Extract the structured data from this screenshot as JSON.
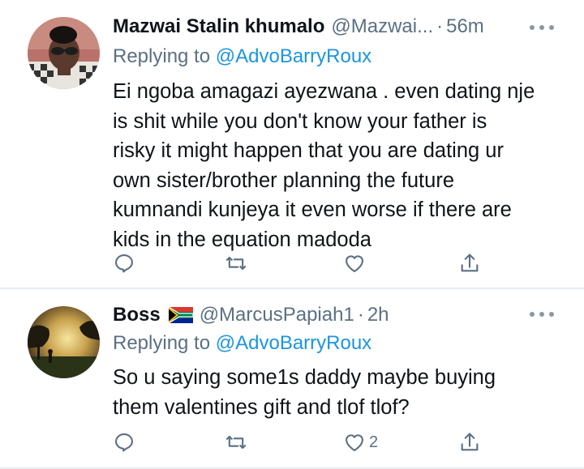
{
  "tweets": [
    {
      "name": "Mazwai Stalin khumalo",
      "handle": "@Mazwai...",
      "time": "56m",
      "replying_label": "Replying to",
      "replying_to": "@AdvoBarryRoux",
      "lines": [
        "Ei ngoba amagazi ayezwana . even  dating nje",
        "is shit while you don't know your  father is",
        "risky it might happen that you are dating ur",
        "own sister/brother planning the future",
        "kumnandi kunjeya it even worse if there are",
        "kids in the equation madoda"
      ],
      "like_count": ""
    },
    {
      "name": "Boss",
      "flag": "south-africa-flag",
      "handle": "@MarcusPapiah1",
      "time": "2h",
      "replying_label": "Replying to",
      "replying_to": "@AdvoBarryRoux",
      "lines": [
        "So u saying some1s daddy maybe buying",
        "them valentines gift and tlof tlof?"
      ],
      "like_count": "2"
    }
  ],
  "icons": {
    "reply": "reply-icon",
    "retweet": "retweet-icon",
    "like": "heart-icon",
    "share": "share-icon",
    "more": "more-icon"
  },
  "colors": {
    "text": "#0f1419",
    "muted": "#5b7083",
    "link": "#1b95e0",
    "divider": "#e6ecf0"
  }
}
